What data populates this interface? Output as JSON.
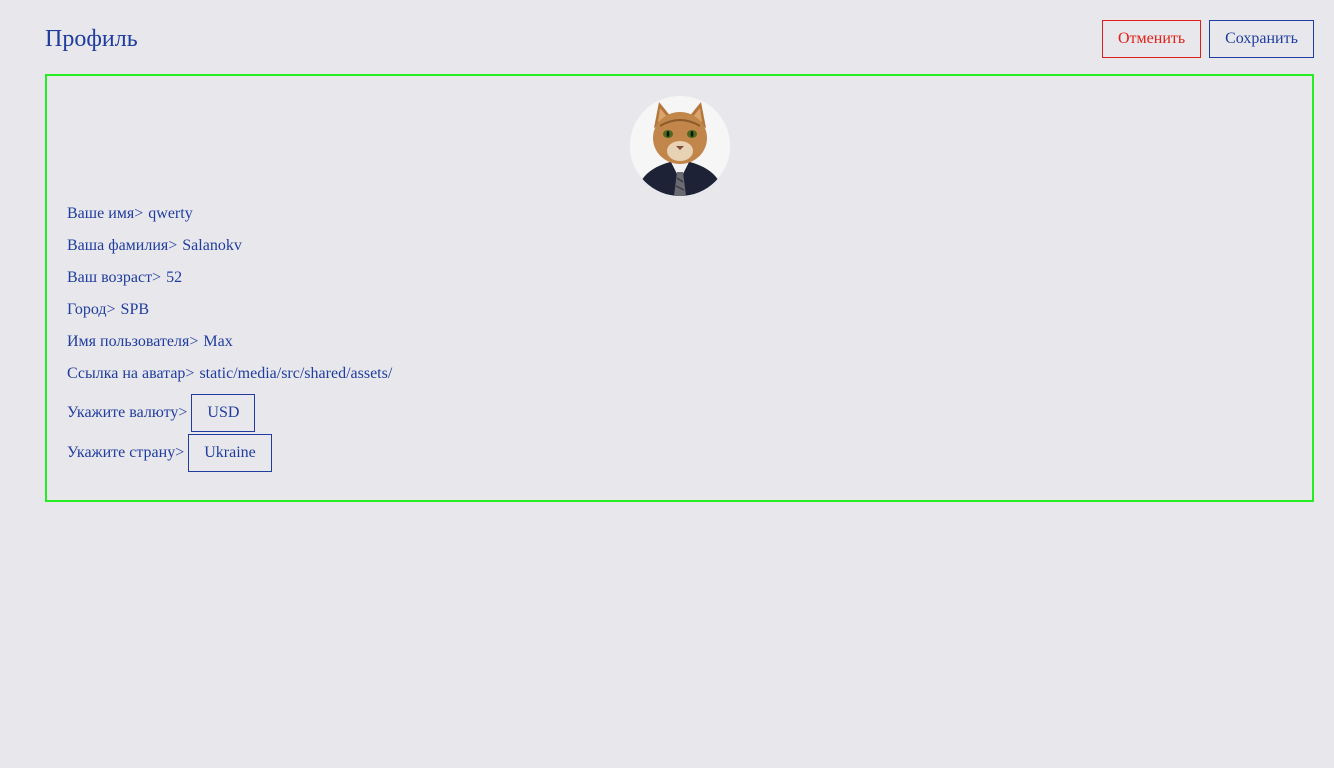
{
  "header": {
    "title": "Профиль",
    "cancel_label": "Отменить",
    "save_label": "Сохранить"
  },
  "profile": {
    "avatar_icon": "cat-in-suit-avatar",
    "fields": [
      {
        "label": "Ваше имя>",
        "value": "qwerty"
      },
      {
        "label": "Ваша фамилия>",
        "value": "Salanokv"
      },
      {
        "label": "Ваш возраст>",
        "value": "52"
      },
      {
        "label": "Город>",
        "value": "SPB"
      },
      {
        "label": "Имя пользователя>",
        "value": "Max"
      },
      {
        "label": "Ссылка на аватар>",
        "value": "static/media/src/shared/assets/"
      }
    ],
    "currency": {
      "label": "Укажите валюту>",
      "value": "USD"
    },
    "country": {
      "label": "Укажите страну>",
      "value": "Ukraine"
    }
  },
  "colors": {
    "background": "#e8e8ec",
    "primary": "#1f3c9e",
    "cancel": "#e0201a",
    "card_border": "#22ee22"
  }
}
